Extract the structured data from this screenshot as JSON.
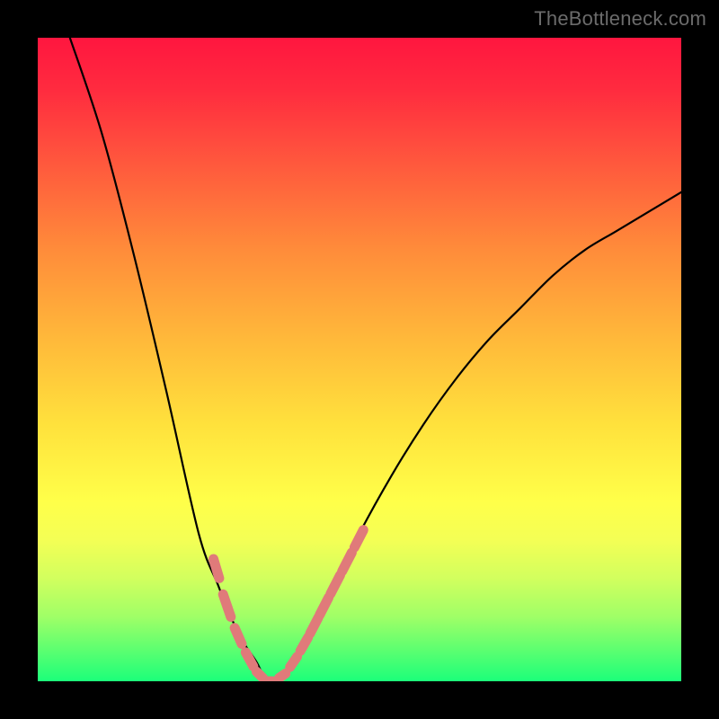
{
  "watermark": "TheBottleneck.com",
  "chart_data": {
    "type": "line",
    "title": "",
    "xlabel": "",
    "ylabel": "",
    "xlim": [
      0,
      100
    ],
    "ylim": [
      0,
      100
    ],
    "grid": false,
    "series": [
      {
        "name": "bottleneck-curve",
        "x": [
          5,
          10,
          15,
          20,
          25,
          28,
          30,
          32,
          34,
          35,
          36,
          37,
          38,
          40,
          42,
          45,
          50,
          55,
          60,
          65,
          70,
          75,
          80,
          85,
          90,
          95,
          100
        ],
        "y": [
          100,
          85,
          66,
          45,
          23,
          15,
          10,
          6,
          3,
          1,
          0,
          0,
          1,
          3,
          7,
          13,
          23,
          32,
          40,
          47,
          53,
          58,
          63,
          67,
          70,
          73,
          76
        ],
        "color": "#000000"
      }
    ],
    "markers": [
      {
        "name": "highlight-segments-left",
        "color": "#e07a7a",
        "segments": [
          {
            "x": [
              27.3,
              28.2
            ],
            "y": [
              19,
              16
            ]
          },
          {
            "x": [
              28.8,
              30.0
            ],
            "y": [
              13.5,
              10
            ]
          },
          {
            "x": [
              30.6,
              31.7
            ],
            "y": [
              8.3,
              5.8
            ]
          },
          {
            "x": [
              32.3,
              33.5
            ],
            "y": [
              4.5,
              2.3
            ]
          },
          {
            "x": [
              34.0,
              35.0
            ],
            "y": [
              1.5,
              0.5
            ]
          }
        ]
      },
      {
        "name": "highlight-segments-bottom",
        "color": "#e07a7a",
        "segments": [
          {
            "x": [
              35.5,
              36.5
            ],
            "y": [
              0,
              0
            ]
          },
          {
            "x": [
              37.5,
              38.5
            ],
            "y": [
              0.5,
              1.2
            ]
          }
        ]
      },
      {
        "name": "highlight-segments-right",
        "color": "#e07a7a",
        "segments": [
          {
            "x": [
              39.2,
              40.3
            ],
            "y": [
              2.2,
              3.8
            ]
          },
          {
            "x": [
              40.8,
              42.0
            ],
            "y": [
              4.7,
              6.8
            ]
          },
          {
            "x": [
              42.3,
              43.6
            ],
            "y": [
              7.4,
              9.9
            ]
          },
          {
            "x": [
              43.8,
              45.2
            ],
            "y": [
              10.3,
              13.0
            ]
          },
          {
            "x": [
              45.5,
              47.0
            ],
            "y": [
              13.6,
              16.5
            ]
          },
          {
            "x": [
              47.3,
              48.8
            ],
            "y": [
              17.1,
              20.0
            ]
          },
          {
            "x": [
              49.2,
              50.6
            ],
            "y": [
              20.8,
              23.5
            ]
          }
        ]
      }
    ],
    "colors": {
      "gradient_top": "#ff163f",
      "gradient_mid": "#ffe13c",
      "gradient_bottom": "#1cff7a",
      "frame": "#000000",
      "marker": "#e07a7a"
    }
  }
}
